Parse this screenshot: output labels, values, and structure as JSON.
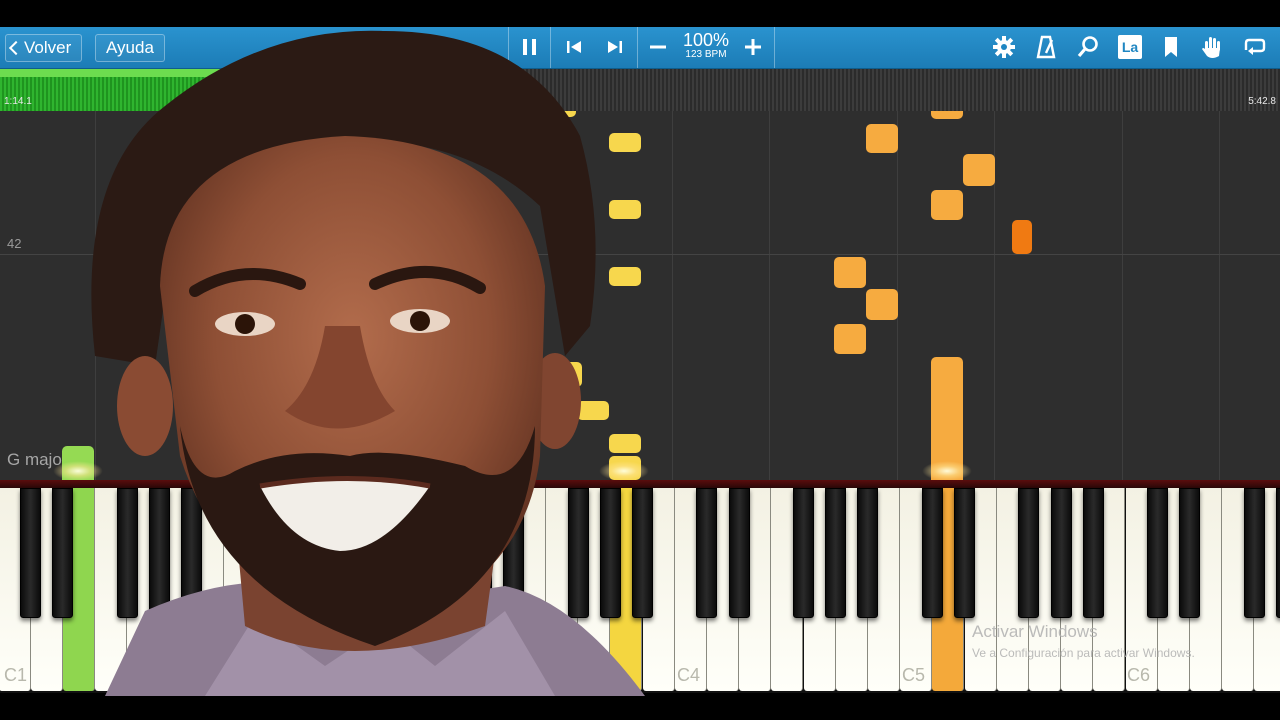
{
  "toolbar": {
    "back_label": "Volver",
    "help_label": "Ayuda",
    "icons": {
      "pause": "pause-icon",
      "previous": "skip-previous-icon",
      "next": "skip-next-icon",
      "minus": "minus-icon",
      "plus": "plus-icon",
      "settings": "gear-icon",
      "metronome": "metronome-icon",
      "zoom": "magnifier-icon",
      "note_labels": "la-label-icon",
      "bookmark": "bookmark-icon",
      "hand": "hand-icon",
      "loop": "loop-icon"
    },
    "note_label_text": "La",
    "tempo_percent": "100%",
    "tempo_bpm": "123 BPM",
    "color": "#1f86c2"
  },
  "progress": {
    "current_time": "1:14.1",
    "total_time": "5:42.8",
    "fraction": 0.216
  },
  "roll": {
    "measure_number": "42",
    "key_signature": "G major",
    "note_colors": {
      "yellow": "#f7d74d",
      "orange": "#f6ab40",
      "dark_orange": "#f07a12",
      "green": "#95da53"
    }
  },
  "keyboard": {
    "octave_labels": [
      "C1",
      "C4",
      "C5",
      "C6"
    ]
  },
  "watermark": {
    "title": "Activar Windows",
    "subtitle": "Ve a Configuración para activar Windows."
  },
  "overlay": {
    "description_icon": "portrait-photo"
  }
}
